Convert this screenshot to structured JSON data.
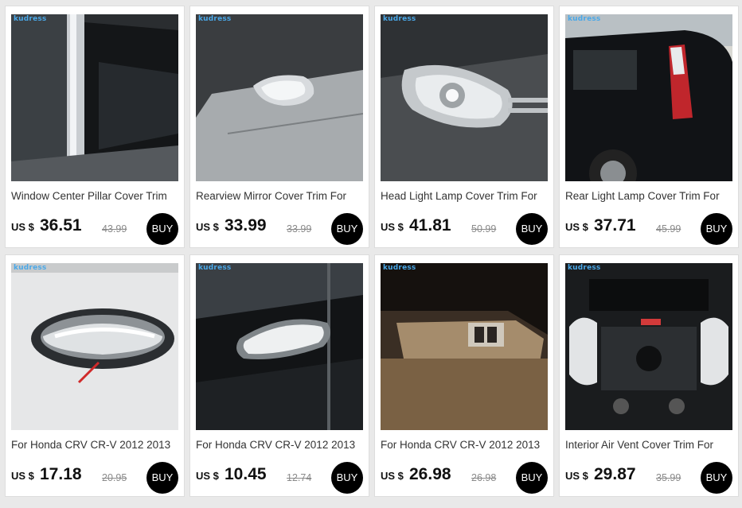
{
  "colors": {
    "accent": "#000000",
    "brand_watermark": "#4aa8e8",
    "old_price": "#8a8a8a",
    "background": "#e9e9e9"
  },
  "products": [
    {
      "brand": "kudress",
      "title": "Window Center Pillar Cover Trim",
      "currency": "US $",
      "price": "36.51",
      "old_price": "43.99",
      "buy_label": "BUY",
      "image": "window-pillar"
    },
    {
      "brand": "kudress",
      "title": "Rearview Mirror Cover Trim For",
      "currency": "US $",
      "price": "33.99",
      "old_price": "33.99",
      "buy_label": "BUY",
      "image": "side-mirror"
    },
    {
      "brand": "kudress",
      "title": "Head Light Lamp Cover Trim For",
      "currency": "US $",
      "price": "41.81",
      "old_price": "50.99",
      "buy_label": "BUY",
      "image": "head-light"
    },
    {
      "brand": "kudress",
      "title": "Rear Light Lamp Cover Trim For",
      "currency": "US $",
      "price": "37.71",
      "old_price": "45.99",
      "buy_label": "BUY",
      "image": "rear-light"
    },
    {
      "brand": "kudress",
      "title": "For Honda CRV CR-V 2012 2013",
      "currency": "US $",
      "price": "17.18",
      "old_price": "20.95",
      "buy_label": "BUY",
      "image": "door-handle-white"
    },
    {
      "brand": "kudress",
      "title": "For Honda CRV CR-V 2012 2013",
      "currency": "US $",
      "price": "10.45",
      "old_price": "12.74",
      "buy_label": "BUY",
      "image": "door-handle-black"
    },
    {
      "brand": "kudress",
      "title": "For Honda CRV CR-V 2012 2013",
      "currency": "US $",
      "price": "26.98",
      "old_price": "26.98",
      "buy_label": "BUY",
      "image": "window-switch"
    },
    {
      "brand": "kudress",
      "title": "Interior Air Vent Cover Trim For",
      "currency": "US $",
      "price": "29.87",
      "old_price": "35.99",
      "buy_label": "BUY",
      "image": "air-vent"
    }
  ]
}
